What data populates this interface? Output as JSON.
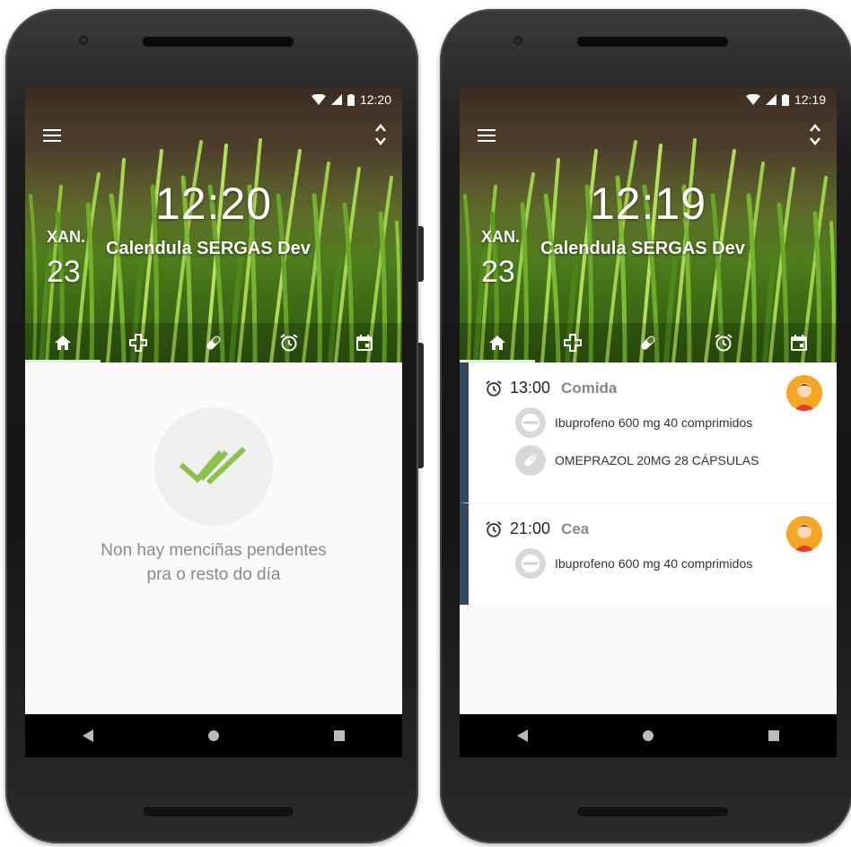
{
  "left_phone": {
    "status_time": "12:20",
    "clock": "12:20",
    "weekday": "XAN.",
    "day": "23",
    "app_name": "Calendula SERGAS Dev",
    "tabs": [
      {
        "icon": "home-icon",
        "active": true
      },
      {
        "icon": "medical-cross-icon",
        "active": false
      },
      {
        "icon": "pill-icon",
        "active": false
      },
      {
        "icon": "alarm-icon",
        "active": false
      },
      {
        "icon": "calendar-icon",
        "active": false
      }
    ],
    "empty_state": {
      "icon": "double-check-icon",
      "line1": "Non hay menciñas pendentes",
      "line2": "pra o resto do día"
    }
  },
  "right_phone": {
    "status_time": "12:19",
    "clock": "12:19",
    "weekday": "XAN.",
    "day": "23",
    "app_name": "Calendula SERGAS Dev",
    "schedule": [
      {
        "time": "13:00",
        "routine": "Comida",
        "meds": [
          {
            "icon": "tablet-icon",
            "name": "Ibuprofeno 600 mg 40 comprimidos"
          },
          {
            "icon": "capsule-icon",
            "name": "OMEPRAZOL 20MG 28 CÁPSULAS"
          }
        ]
      },
      {
        "time": "21:00",
        "routine": "Cea",
        "meds": [
          {
            "icon": "tablet-icon",
            "name": "Ibuprofeno 600 mg 40 comprimidos"
          }
        ]
      }
    ]
  },
  "colors": {
    "card_accent": "#34495e",
    "check_green": "#8bc34a",
    "avatar_orange": "#f5a623",
    "nav_bar": "#000000"
  }
}
